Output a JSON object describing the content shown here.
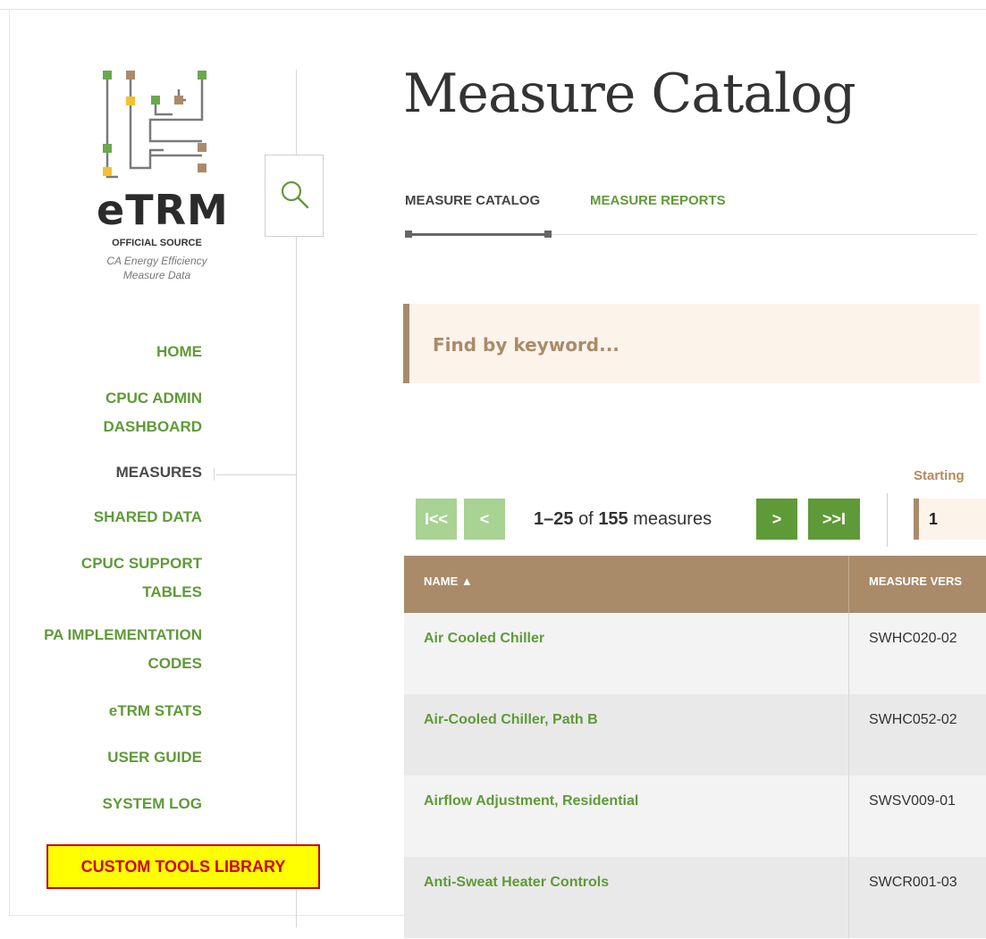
{
  "logo": {
    "wordmark": "eTRM",
    "official": "OFFICIAL SOURCE",
    "tagline_line1": "CA Energy Efficiency",
    "tagline_line2": "Measure Data",
    "colors": {
      "green": "#6aa84f",
      "tan": "#a98b6a",
      "yellow": "#f1c232",
      "line": "#777777"
    }
  },
  "sidebar": {
    "items": [
      {
        "label": "HOME",
        "active": false
      },
      {
        "label": "CPUC ADMIN",
        "label2": "DASHBOARD",
        "active": false
      },
      {
        "label": "MEASURES",
        "active": true
      },
      {
        "label": "SHARED DATA",
        "active": false
      },
      {
        "label": "CPUC SUPPORT",
        "label2": "TABLES",
        "active": false
      },
      {
        "label": "PA IMPLEMENTATION",
        "label2": "CODES",
        "active": false
      },
      {
        "label": "eTRM STATS",
        "active": false
      },
      {
        "label": "USER GUIDE",
        "active": false
      },
      {
        "label": "SYSTEM LOG",
        "active": false
      }
    ],
    "custom_tools": "CUSTOM TOOLS LIBRARY",
    "search_icon": "search-icon"
  },
  "page": {
    "title": "Measure Catalog",
    "tabs": [
      {
        "label": "MEASURE CATALOG",
        "active": true
      },
      {
        "label": "MEASURE REPORTS",
        "active": false
      }
    ],
    "search_placeholder": "Find by keyword..."
  },
  "pagination": {
    "first_glyph": "I<<",
    "prev_glyph": "<",
    "next_glyph": ">",
    "last_glyph": ">>I",
    "range": "1–25",
    "of_text": "of",
    "total": "155",
    "unit": "measures",
    "starting_label": "Starting",
    "starting_value": "1"
  },
  "table": {
    "columns": [
      "NAME ▲",
      "MEASURE VERS"
    ],
    "rows": [
      {
        "name": "Air Cooled Chiller",
        "version": "SWHC020-02"
      },
      {
        "name": "Air-Cooled Chiller, Path B",
        "version": "SWHC052-02"
      },
      {
        "name": "Airflow Adjustment, Residential",
        "version": "SWSV009-01"
      },
      {
        "name": "Anti-Sweat Heater Controls",
        "version": "SWCR001-03"
      }
    ]
  },
  "colors": {
    "accent_green": "#5f9a38",
    "accent_tan": "#a98b6a",
    "highlight_yellow": "#ffff00",
    "highlight_red": "#c0000a"
  }
}
